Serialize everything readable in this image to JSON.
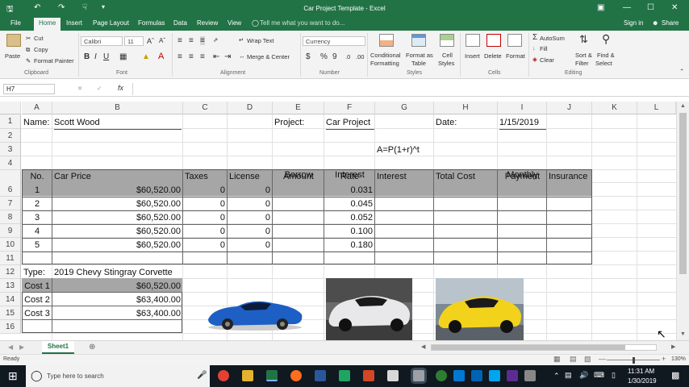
{
  "window": {
    "title": "Car Project Template - Excel",
    "signin": "Sign in",
    "share": "Share"
  },
  "tabs": [
    "File",
    "Home",
    "Insert",
    "Page Layout",
    "Formulas",
    "Data",
    "Review",
    "View"
  ],
  "tellme": "Tell me what you want to do...",
  "ribbon": {
    "clipboard": {
      "paste": "Paste",
      "cut": "Cut",
      "copy": "Copy",
      "format_painter": "Format Painter",
      "label": "Clipboard"
    },
    "font": {
      "name": "Calibri",
      "size": "11",
      "bold": "B",
      "italic": "I",
      "underline": "U",
      "label": "Font"
    },
    "alignment": {
      "wrap": "Wrap Text",
      "merge": "Merge & Center",
      "label": "Alignment"
    },
    "number": {
      "format": "Currency",
      "dollar": "$",
      "percent": "%",
      "comma": "9",
      "label": "Number"
    },
    "styles": {
      "conditional": "Conditional",
      "formatting": "Formatting",
      "format_as": "Format as",
      "table": "Table",
      "cell": "Cell",
      "styles": "Styles",
      "label": "Styles"
    },
    "cells": {
      "insert": "Insert",
      "delete": "Delete",
      "format": "Format",
      "label": "Cells"
    },
    "editing": {
      "autosum": "AutoSum",
      "fill": "Fill",
      "clear": "Clear",
      "sort": "Sort &",
      "filter": "Filter",
      "find": "Find &",
      "select": "Select",
      "label": "Editing"
    }
  },
  "formula_bar": {
    "name_box": "H7",
    "fx": "fx",
    "value": ""
  },
  "columns": [
    "A",
    "B",
    "C",
    "D",
    "E",
    "F",
    "G",
    "H",
    "I",
    "J",
    "K",
    "L"
  ],
  "rows": [
    "1",
    "2",
    "3",
    "4",
    "5",
    "6",
    "7",
    "8",
    "9",
    "10",
    "11",
    "12",
    "13",
    "14",
    "15",
    "16"
  ],
  "sheet": {
    "name_label": "Name:",
    "name_value": "Scott Wood",
    "project_label": "Project:",
    "project_value": "Car Project",
    "date_label": "Date:",
    "date_value": "1/15/2019",
    "formula_text": "A=P(1+r)^t",
    "headers": {
      "no": "No.",
      "car_price": "Car Price",
      "taxes": "Taxes",
      "license": "License",
      "borrow1": "Borrow",
      "borrow2": "Amount",
      "interest1": "Interest",
      "interest2": "Rate",
      "interest": "Interest",
      "total": "Total Cost",
      "monthly1": "Monthly",
      "monthly2": "Payment",
      "insurance": "Insurance"
    },
    "data": [
      {
        "no": "1",
        "price": "$60,520.00",
        "taxes": "0",
        "license": "0",
        "rate": "0.031"
      },
      {
        "no": "2",
        "price": "$60,520.00",
        "taxes": "0",
        "license": "0",
        "rate": "0.045"
      },
      {
        "no": "3",
        "price": "$60,520.00",
        "taxes": "0",
        "license": "0",
        "rate": "0.052"
      },
      {
        "no": "4",
        "price": "$60,520.00",
        "taxes": "0",
        "license": "0",
        "rate": "0.100"
      },
      {
        "no": "5",
        "price": "$60,520.00",
        "taxes": "0",
        "license": "0",
        "rate": "0.180"
      }
    ],
    "type_label": "Type:",
    "type_value": "2019 Chevy Stingray Corvette",
    "costs": [
      {
        "label": "Cost 1",
        "value": "$60,520.00"
      },
      {
        "label": "Cost 2",
        "value": "$63,400.00"
      },
      {
        "label": "Cost 3",
        "value": "$63,400.00"
      }
    ]
  },
  "sheet_tab": "Sheet1",
  "status": {
    "ready": "Ready",
    "zoom": "130%"
  },
  "taskbar": {
    "search_placeholder": "Type here to search",
    "time": "11:31 AM",
    "date": "1/30/2019"
  },
  "colors": {
    "excel_green": "#217346",
    "car1": "#1d5fc4",
    "car2": "#e8e8ea",
    "car3": "#f3d21c"
  }
}
